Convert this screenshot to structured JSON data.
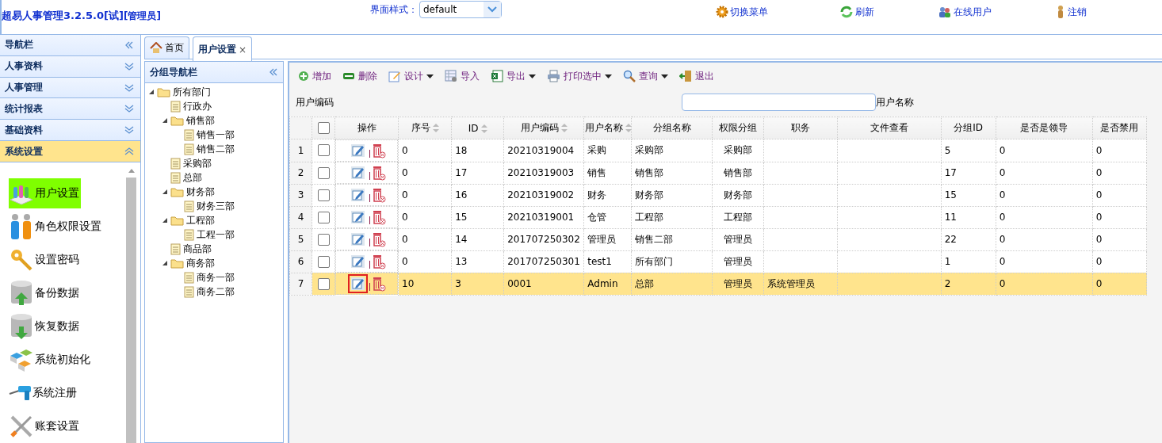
{
  "header": {
    "title": "超易人事管理3.2.5.0[试]",
    "role": "[管理员]",
    "style_label": "界面样式：",
    "style_select": {
      "value": "default"
    },
    "links": [
      {
        "kind": "gear",
        "label": "切换菜单"
      },
      {
        "kind": "refresh",
        "label": "刷新"
      },
      {
        "kind": "users",
        "label": "在线用户"
      },
      {
        "kind": "person",
        "label": "注销"
      }
    ]
  },
  "sidebar": {
    "title": "导航栏",
    "sections": [
      {
        "label": "人事资料",
        "expanded": false
      },
      {
        "label": "人事管理",
        "expanded": false
      },
      {
        "label": "统计报表",
        "expanded": false
      },
      {
        "label": "基础资料",
        "expanded": false
      },
      {
        "label": "系统设置",
        "expanded": true
      }
    ],
    "items": [
      {
        "kind": "users",
        "label": "用户设置",
        "selected": true
      },
      {
        "kind": "people",
        "label": "角色权限设置",
        "selected": false
      },
      {
        "kind": "key",
        "label": "设置密码",
        "selected": false
      },
      {
        "kind": "db-up",
        "label": "备份数据",
        "selected": false
      },
      {
        "kind": "db-down",
        "label": "恢复数据",
        "selected": false
      },
      {
        "kind": "cubes",
        "label": "系统初始化",
        "selected": false
      },
      {
        "kind": "drill",
        "label": "系统注册",
        "selected": false
      },
      {
        "kind": "tools",
        "label": "账套设置",
        "selected": false
      }
    ]
  },
  "tabs": [
    {
      "label": "首页",
      "selected": false
    },
    {
      "label": "用户设置",
      "selected": true,
      "close": "×"
    }
  ],
  "group_nav": {
    "title": "分组导航栏",
    "tree": [
      {
        "label": "所有部门",
        "expanded": true,
        "children": [
          {
            "label": "行政办"
          },
          {
            "label": "销售部",
            "expanded": true,
            "children": [
              {
                "label": "销售一部"
              },
              {
                "label": "销售二部"
              }
            ]
          },
          {
            "label": "采购部"
          },
          {
            "label": "总部"
          },
          {
            "label": "财务部",
            "expanded": true,
            "children": [
              {
                "label": "财务三部"
              }
            ]
          },
          {
            "label": "工程部",
            "expanded": true,
            "children": [
              {
                "label": "工程一部"
              }
            ]
          },
          {
            "label": "商品部"
          },
          {
            "label": "商务部",
            "expanded": true,
            "children": [
              {
                "label": "商务一部"
              },
              {
                "label": "商务二部"
              }
            ]
          }
        ]
      }
    ]
  },
  "toolbar": [
    {
      "kind": "add",
      "label": "增加",
      "dropdown": false
    },
    {
      "kind": "delete",
      "label": "删除",
      "dropdown": false
    },
    {
      "kind": "design",
      "label": "设计",
      "dropdown": true
    },
    {
      "kind": "import",
      "label": "导入",
      "dropdown": false
    },
    {
      "kind": "export",
      "label": "导出",
      "dropdown": true
    },
    {
      "kind": "print",
      "label": "打印选中",
      "dropdown": true
    },
    {
      "kind": "search",
      "label": "查询",
      "dropdown": true
    },
    {
      "kind": "exit",
      "label": "退出",
      "dropdown": false
    }
  ],
  "filters": {
    "code_label": "用户编码",
    "name_label": "用户名称"
  },
  "table": {
    "select_all_checked": false,
    "columns": [
      {
        "label": "操作",
        "sortable": false
      },
      {
        "label": "序号",
        "sortable": true
      },
      {
        "label": "ID",
        "sortable": true
      },
      {
        "label": "用户编码",
        "sortable": true
      },
      {
        "label": "用户名称",
        "sortable": true
      },
      {
        "label": "分组名称",
        "sortable": false
      },
      {
        "label": "权限分组",
        "sortable": false
      },
      {
        "label": "职务",
        "sortable": false
      },
      {
        "label": "文件查看",
        "sortable": false
      },
      {
        "label": "分组ID",
        "sortable": false
      },
      {
        "label": "是否是领导",
        "sortable": false
      },
      {
        "label": "是否禁用",
        "sortable": false
      }
    ],
    "rows": [
      {
        "num": "1",
        "checked": false,
        "selected": false,
        "edit_focused": false,
        "cells": [
          "",
          "0",
          "18",
          "20210319004",
          "采购",
          "采购部",
          "采购部",
          "",
          "",
          "5",
          "0",
          "0"
        ]
      },
      {
        "num": "2",
        "checked": false,
        "selected": false,
        "edit_focused": false,
        "cells": [
          "",
          "0",
          "17",
          "20210319003",
          "销售",
          "销售部",
          "销售部",
          "",
          "",
          "17",
          "0",
          "0"
        ]
      },
      {
        "num": "3",
        "checked": false,
        "selected": false,
        "edit_focused": false,
        "cells": [
          "",
          "0",
          "16",
          "20210319002",
          "财务",
          "财务部",
          "财务部",
          "",
          "",
          "15",
          "0",
          "0"
        ]
      },
      {
        "num": "4",
        "checked": false,
        "selected": false,
        "edit_focused": false,
        "cells": [
          "",
          "0",
          "15",
          "20210319001",
          "仓管",
          "工程部",
          "工程部",
          "",
          "",
          "11",
          "0",
          "0"
        ]
      },
      {
        "num": "5",
        "checked": false,
        "selected": false,
        "edit_focused": false,
        "cells": [
          "",
          "0",
          "14",
          "201707250302",
          "管理员",
          "销售二部",
          "管理员",
          "",
          "",
          "22",
          "0",
          "0"
        ]
      },
      {
        "num": "6",
        "checked": false,
        "selected": false,
        "edit_focused": false,
        "cells": [
          "",
          "0",
          "13",
          "201707250301",
          "test1",
          "所有部门",
          "管理员",
          "",
          "",
          "1",
          "0",
          "0"
        ]
      },
      {
        "num": "7",
        "checked": false,
        "selected": true,
        "edit_focused": true,
        "cells": [
          "",
          "10",
          "3",
          "0001",
          "Admin",
          "总部",
          "管理员",
          "系统管理员",
          "",
          "2",
          "0",
          "0"
        ]
      }
    ]
  }
}
